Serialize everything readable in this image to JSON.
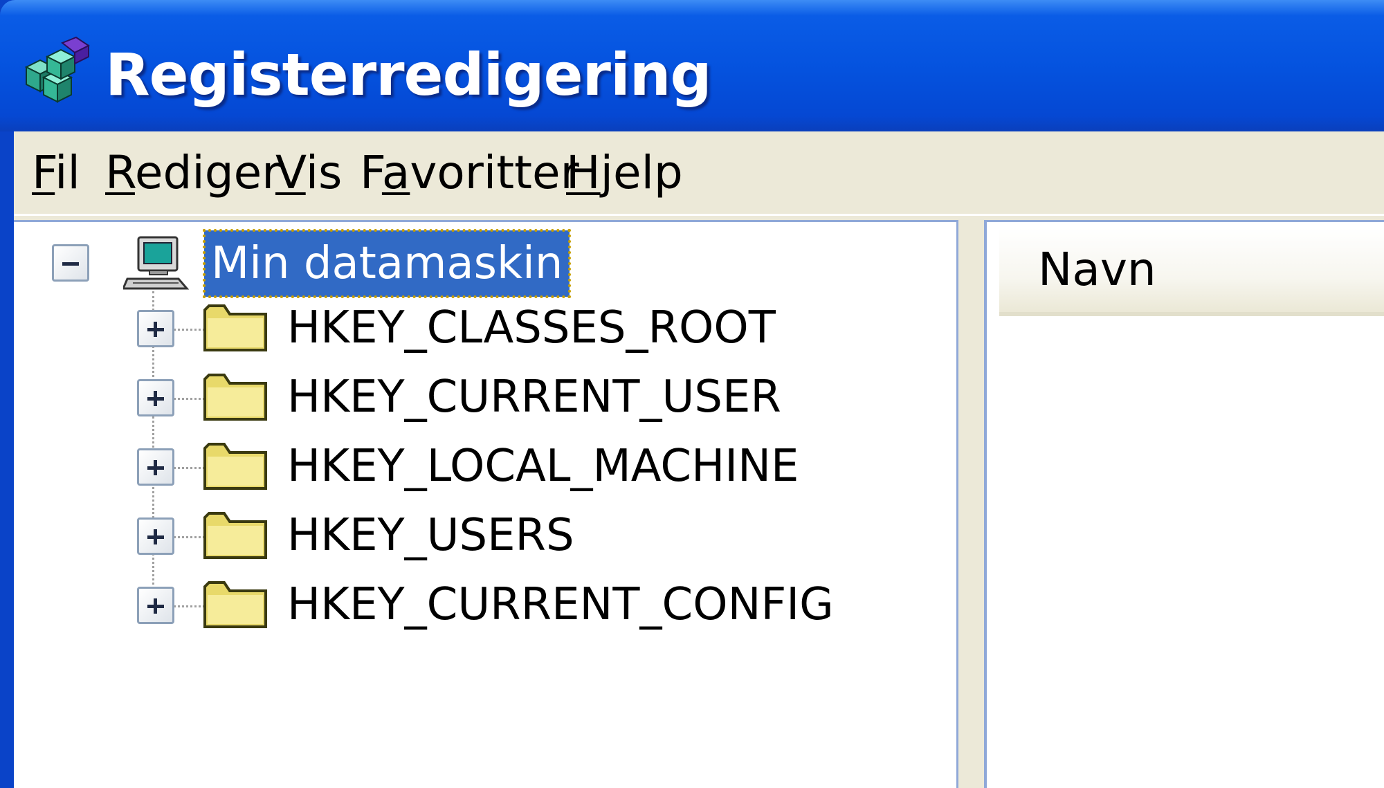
{
  "window": {
    "title": "Registerredigering",
    "icon": "regedit-icon"
  },
  "menu": [
    {
      "label_first": "F",
      "label_rest": "il",
      "underline": "F"
    },
    {
      "label_first": "R",
      "label_rest": "ediger",
      "underline": "R"
    },
    {
      "label_first": "V",
      "label_rest": "is",
      "underline": "V"
    },
    {
      "label_pre": "F",
      "label_u": "a",
      "label_rest": "voritter",
      "underline": "a"
    },
    {
      "label_first": "H",
      "label_rest": "jelp",
      "underline": "H"
    }
  ],
  "tree": {
    "root": {
      "label": "Min datamaskin",
      "icon": "computer-icon",
      "expanded": true,
      "selected": true
    },
    "children": [
      {
        "label": "HKEY_CLASSES_ROOT",
        "icon": "folder-icon"
      },
      {
        "label": "HKEY_CURRENT_USER",
        "icon": "folder-icon"
      },
      {
        "label": "HKEY_LOCAL_MACHINE",
        "icon": "folder-icon"
      },
      {
        "label": "HKEY_USERS",
        "icon": "folder-icon"
      },
      {
        "label": "HKEY_CURRENT_CONFIG",
        "icon": "folder-icon"
      }
    ]
  },
  "list": {
    "columns": [
      "Navn"
    ]
  },
  "colors": {
    "titlebar": "#0553df",
    "selection": "#316ac5",
    "chrome": "#ece9d8"
  }
}
